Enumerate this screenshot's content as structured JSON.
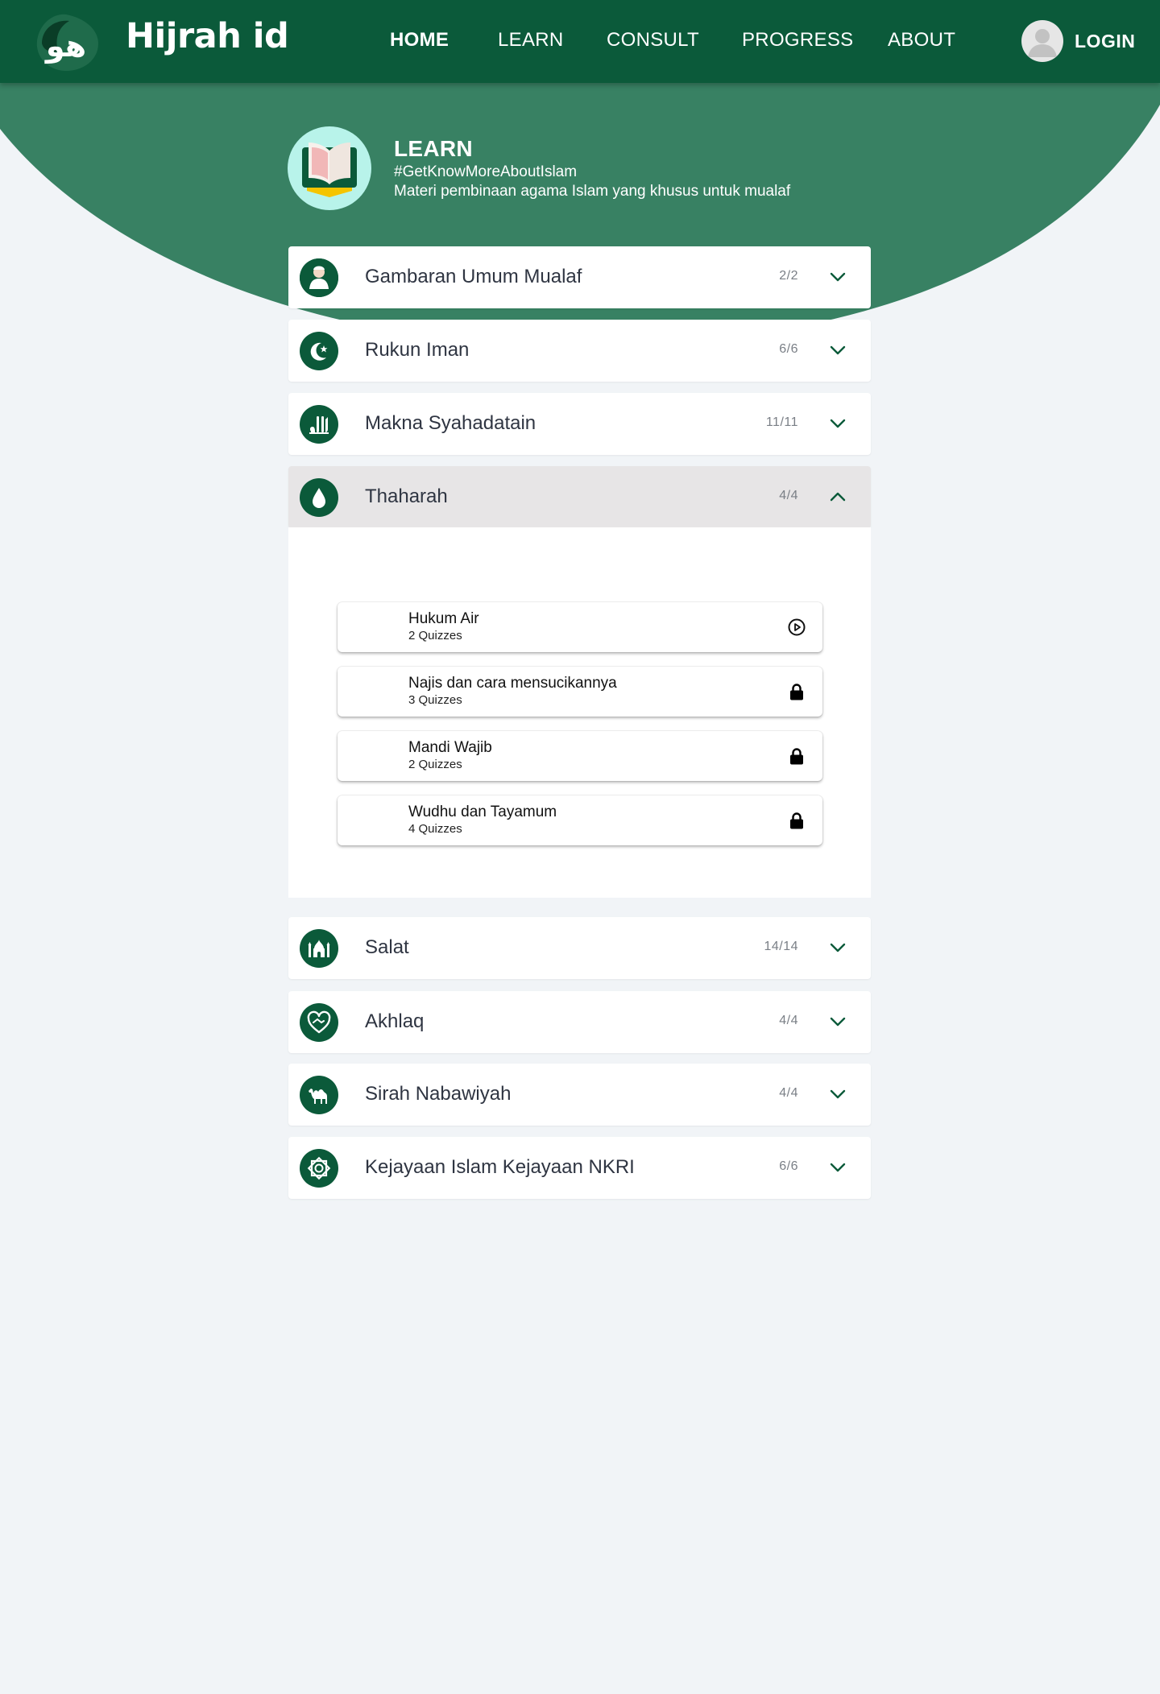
{
  "app": {
    "brand": "Hijrah id",
    "logo_glyph": "هو"
  },
  "nav": {
    "items": [
      {
        "label": "HOME",
        "active": true
      },
      {
        "label": "LEARN",
        "active": false
      },
      {
        "label": "CONSULT",
        "active": false
      },
      {
        "label": "PROGRESS",
        "active": false
      },
      {
        "label": "ABOUT",
        "active": false
      }
    ],
    "login_label": "LOGIN"
  },
  "hero": {
    "title": "LEARN",
    "tag": "#GetKnowMoreAboutIslam",
    "description": "Materi pembinaan agama Islam yang khusus untuk mualaf",
    "icon": "quran-book-icon"
  },
  "modules": [
    {
      "title": "Gambaran Umum Mualaf",
      "count": "2/2",
      "icon": "person-icon",
      "expanded": false
    },
    {
      "title": "Rukun Iman",
      "count": "6/6",
      "icon": "crescent-star-icon",
      "expanded": false
    },
    {
      "title": "Makna Syahadatain",
      "count": "11/11",
      "icon": "allah-calligraphy-icon",
      "expanded": false
    },
    {
      "title": "Thaharah",
      "count": "4/4",
      "icon": "water-drop-icon",
      "expanded": true
    },
    {
      "title": "Salat",
      "count": "14/14",
      "icon": "mosque-icon",
      "expanded": false
    },
    {
      "title": "Akhlaq",
      "count": "4/4",
      "icon": "handshake-heart-icon",
      "expanded": false
    },
    {
      "title": "Sirah Nabawiyah",
      "count": "4/4",
      "icon": "camel-icon",
      "expanded": false
    },
    {
      "title": "Kejayaan Islam Kejayaan NKRI",
      "count": "6/6",
      "icon": "islamic-star-icon",
      "expanded": false
    }
  ],
  "lessons": [
    {
      "title": "Hukum Air",
      "subtitle": "2 Quizzes",
      "status": "play",
      "icon": "play-circle-icon"
    },
    {
      "title": "Najis dan cara mensucikannya",
      "subtitle": "3 Quizzes",
      "status": "locked",
      "icon": "lock-icon"
    },
    {
      "title": "Mandi Wajib",
      "subtitle": "2 Quizzes",
      "status": "locked",
      "icon": "lock-icon"
    },
    {
      "title": "Wudhu dan Tayamum",
      "subtitle": "4 Quizzes",
      "status": "locked",
      "icon": "lock-icon"
    }
  ],
  "colors": {
    "primary": "#0b5a3a",
    "hero": "#388163",
    "page": "#f1f4f7",
    "open_row": "#e7e5e6"
  }
}
